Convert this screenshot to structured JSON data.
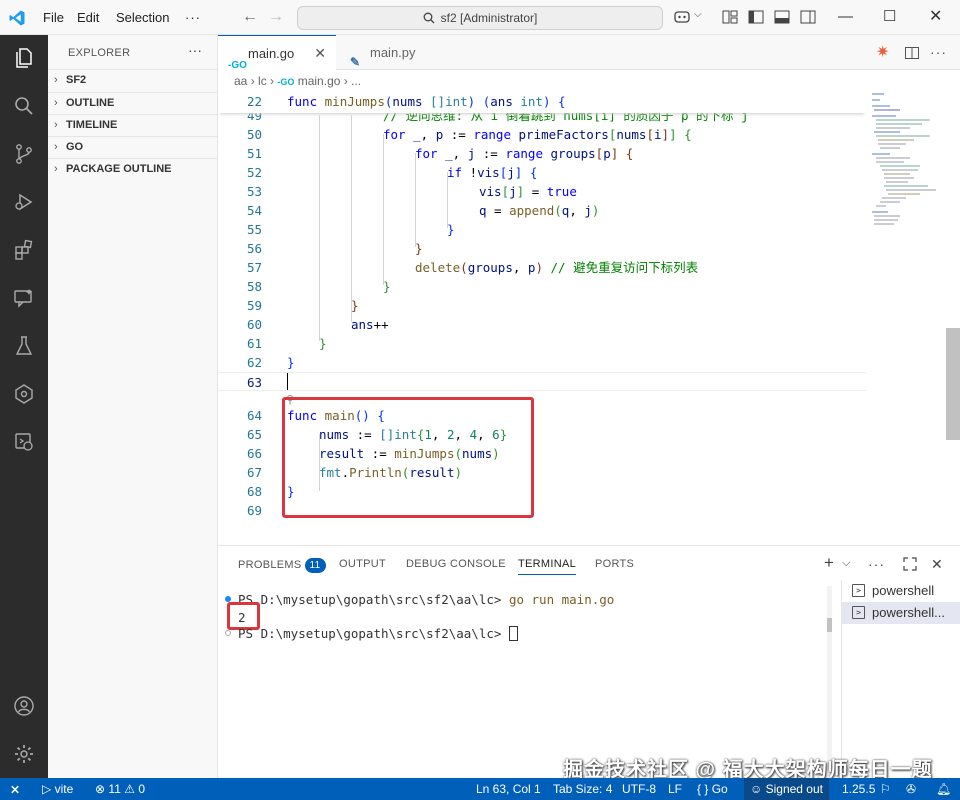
{
  "app": {
    "menu": [
      "File",
      "Edit",
      "Selection"
    ],
    "command_center": "sf2 [Administrator]"
  },
  "explorer": {
    "title": "EXPLORER",
    "sections": [
      "SF2",
      "OUTLINE",
      "TIMELINE",
      "GO",
      "PACKAGE OUTLINE"
    ]
  },
  "tabs": [
    {
      "label": "main.go",
      "icon": "go-file-icon",
      "active": true
    },
    {
      "label": "main.py",
      "icon": "python-file-icon",
      "active": false
    }
  ],
  "breadcrumb": [
    "aa",
    "lc",
    "main.go",
    "..."
  ],
  "editor": {
    "sticky": {
      "num": "22",
      "text": "func minJumps(nums []int) (ans int) {"
    },
    "partial": {
      "num": "49",
      "text": "// 逆向思维: 从 i 倒着跳到 nums[i] 的质因子 p 的下标 j"
    },
    "lines": [
      {
        "num": "50",
        "text": "for _, p := range primeFactors[nums[i]] {"
      },
      {
        "num": "51",
        "text": "for _, j := range groups[p] {"
      },
      {
        "num": "52",
        "text": "if !vis[j] {"
      },
      {
        "num": "53",
        "text": "vis[j] = true"
      },
      {
        "num": "54",
        "text": "q = append(q, j)"
      },
      {
        "num": "55",
        "text": "}"
      },
      {
        "num": "56",
        "text": "}"
      },
      {
        "num": "57",
        "text": "delete(groups, p) // 避免重复访问下标列表"
      },
      {
        "num": "58",
        "text": "}"
      },
      {
        "num": "59",
        "text": "}"
      },
      {
        "num": "60",
        "text": "ans++"
      },
      {
        "num": "61",
        "text": "}"
      },
      {
        "num": "62",
        "text": "}"
      },
      {
        "num": "63",
        "text": ""
      },
      {
        "num": "64",
        "text": "func main() {"
      },
      {
        "num": "65",
        "text": "nums := []int{1, 2, 4, 6}"
      },
      {
        "num": "66",
        "text": "result := minJumps(nums)"
      },
      {
        "num": "67",
        "text": "fmt.Println(result)"
      },
      {
        "num": "68",
        "text": "}"
      },
      {
        "num": "69",
        "text": ""
      }
    ]
  },
  "panel": {
    "tabs": [
      "PROBLEMS",
      "OUTPUT",
      "DEBUG CONSOLE",
      "TERMINAL",
      "PORTS"
    ],
    "problems_count": "11",
    "terminal": {
      "prompt1": "PS D:\\mysetup\\gopath\\src\\sf2\\aa\\lc>",
      "command": "go run main.go",
      "output": "2",
      "prompt2": "PS D:\\mysetup\\gopath\\src\\sf2\\aa\\lc>"
    },
    "terminal_list": [
      "powershell",
      "powershell..."
    ]
  },
  "statusbar": {
    "remote": "⨯",
    "vite": "vite",
    "errors": "11",
    "warnings": "0",
    "position": "Ln 63, Col 1",
    "tab_size": "Tab Size: 4",
    "encoding": "UTF-8",
    "eol": "LF",
    "language": "Go",
    "account": "Signed out",
    "go_version": "1.25.5"
  },
  "watermark": "掘金技术社区 @ 福大大架构师每日一题",
  "colors": {
    "accent": "#005fb8",
    "highlight_box": "#d9363e",
    "activity_bar": "#2c2c2c"
  }
}
